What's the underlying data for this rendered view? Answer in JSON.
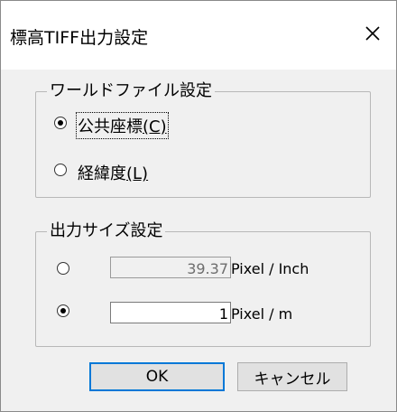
{
  "window": {
    "title": "標高TIFF出力設定"
  },
  "world_file_group": {
    "legend": "ワールドファイル設定",
    "options": [
      {
        "label_main": "公共座標",
        "label_key": "(C)",
        "selected": true
      },
      {
        "label_main": "経緯度",
        "label_key": "(L)",
        "selected": false
      }
    ]
  },
  "output_size_group": {
    "legend": "出力サイズ設定",
    "rows": [
      {
        "value": "39.37",
        "unit": "Pixel / Inch",
        "selected": false,
        "enabled": false
      },
      {
        "value": "1",
        "unit": "Pixel / m",
        "selected": true,
        "enabled": true
      }
    ]
  },
  "buttons": {
    "ok": "OK",
    "cancel": "キャンセル"
  }
}
